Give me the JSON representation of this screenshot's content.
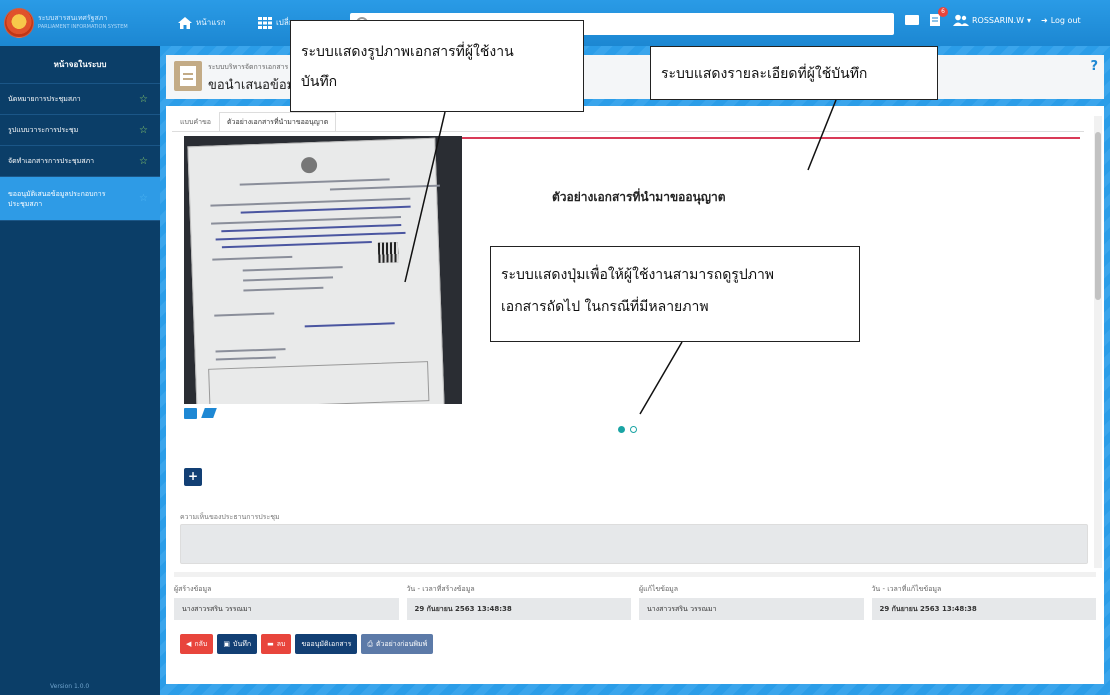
{
  "topbar": {
    "logo_line1": "ระบบสารสนเทศรัฐสภา",
    "logo_line2": "PARLIAMENT INFORMATION SYSTEM",
    "home_label": "หน้าแรก",
    "systems_label": "เปลี่ยนระบบ",
    "notification_count": "6",
    "username": "ROSSARIN.W",
    "logout_label": "Log out"
  },
  "sidebar": {
    "header": "หน้าจอในระบบ",
    "items": [
      {
        "label": "นัดหมายการประชุมสภา"
      },
      {
        "label": "รูปแบบวาระการประชุม"
      },
      {
        "label": "จัดทำเอกสารการประชุมสภา"
      },
      {
        "label": "ขออนุมัติเสนอข้อมูลประกอบการประชุมสภา"
      }
    ],
    "version": "Version 1.0.0"
  },
  "page": {
    "subtitle": "ระบบบริหารจัดการเอกสาร",
    "title": "ขอนำเสนอข้อมูล",
    "help": "?"
  },
  "tabs": [
    {
      "label": "แบบคำขอ"
    },
    {
      "label": "ตัวอย่างเอกสารที่นำมาขออนุญาต"
    }
  ],
  "document": {
    "caption": "ตัวอย่างเอกสารที่นำมาขออนุญาต"
  },
  "comment": {
    "label": "ความเห็นของประธานการประชุม",
    "value": ""
  },
  "meta": [
    {
      "label": "ผู้สร้างข้อมูล",
      "value": "นางสาวรสริน วรรณมา"
    },
    {
      "label": "วัน - เวลาที่สร้างข้อมูล",
      "value": "29 กันยายน 2563 13:48:38"
    },
    {
      "label": "ผู้แก้ไขข้อมูล",
      "value": "นางสาวรสริน วรรณมา"
    },
    {
      "label": "วัน - เวลาที่แก้ไขข้อมูล",
      "value": "29 กันยายน 2563 13:48:38"
    }
  ],
  "actions": {
    "back": "กลับ",
    "save": "บันทึก",
    "delete": "ลบ",
    "approve": "ขออนุมัติเอกสาร",
    "preview": "ตัวอย่างก่อนพิมพ์"
  },
  "callouts": {
    "c1_line1": "ระบบแสดงรูปภาพเอกสารที่ผู้ใช้งาน",
    "c1_line2": "บันทึก",
    "c2": "ระบบแสดงรายละเอียดที่ผู้ใช้บันทึก",
    "c3_line1": "ระบบแสดงปุ่มเพื่อให้ผู้ใช้งานสามารถดูรูปภาพ",
    "c3_line2": "เอกสารถัดไป ในกรณีที่มีหลายภาพ"
  },
  "carousel": {
    "total": 2,
    "active": 1
  },
  "colors": {
    "accent": "#1e88d4",
    "sidebar": "#0b3e68",
    "danger": "#e8453c",
    "navy": "#123f74"
  }
}
